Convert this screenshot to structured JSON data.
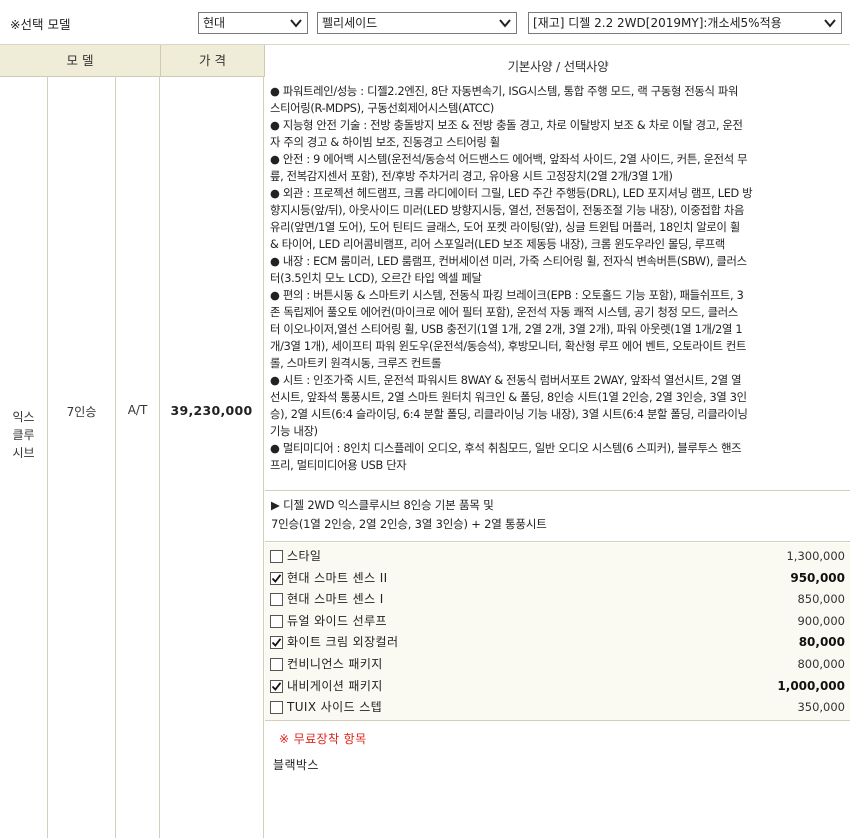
{
  "top": {
    "title": "※선택 모델",
    "brand_select": "현대",
    "model_select": "펠리세이드",
    "trim_select": "[재고] 디젤 2.2 2WD[2019MY]:개소세5%적용"
  },
  "header": {
    "model": "모 델",
    "price": "가 격",
    "spec": "기본사양 / 선택사양"
  },
  "row": {
    "trim": "익스\n클루\n시브",
    "seats": "7인승",
    "trans": "A/T",
    "price": "39,230,000"
  },
  "spec_lines": [
    "● 파워트레인/성능 : 디젤2.2엔진, 8단 자동변속기, ISG시스템, 통합 주행 모드, 랙 구동형 전동식 파워",
    "스티어링(R-MDPS), 구동선회제어시스템(ATCC)",
    "● 지능형 안전 기술 : 전방 충돌방지 보조 & 전방 충돌 경고, 차로 이탈방지 보조 & 차로 이탈 경고, 운전",
    "자 주의 경고 & 하이빔 보조, 진동경고 스티어링 휠",
    "● 안전 : 9 에어백 시스템(운전석/동승석 어드밴스드 에어백, 앞좌석 사이드, 2열 사이드, 커튼, 운전석 무",
    "릎, 전복감지센서 포함), 전/후방 주차거리 경고, 유아용 시트 고정장치(2열 2개/3열 1개)",
    "● 외관 : 프로젝션 헤드램프, 크롬 라디에이터 그릴, LED 주간 주행등(DRL), LED 포지셔닝 램프, LED 방",
    "향지시등(앞/뒤), 아웃사이드 미러(LED 방향지시등, 열선, 전동접이, 전동조절 기능 내장), 이중접합 차음",
    "유리(앞면/1열 도어), 도어 틴티드 글래스, 도어 포켓 라이팅(앞), 싱글 트윈팁 머플러, 18인치 알로이 휠",
    "& 타이어, LED 리어콤비램프, 리어 스포일러(LED 보조 제동등 내장), 크롬 윈도우라인 몰딩, 루프랙",
    "● 내장 : ECM 룸미러, LED 룸램프, 컨버세이션 미러, 가죽 스티어링 휠, 전자식 변속버튼(SBW), 클러스",
    "터(3.5인치 모노 LCD), 오르간 타입 엑셀 페달",
    "● 편의 : 버튼시동 & 스마트키 시스템, 전동식 파킹 브레이크(EPB : 오토홀드 기능 포함), 패들쉬프트, 3",
    "존 독립제어 풀오토 에어컨(마이크로 에어 필터 포함), 운전석 자동 쾌적 시스템, 공기 청정 모드, 클러스",
    "터 이오나이저,열선 스티어링 휠, USB 충전기(1열 1개, 2열 2개, 3열 2개), 파워 아웃렛(1열 1개/2열 1",
    "개/3열 1개), 세이프티 파워 윈도우(운전석/동승석), 후방모니터, 확산형 루프 에어 벤트, 오토라이트 컨트",
    "롤, 스마트키 원격시동, 크루즈 컨트롤",
    "● 시트 : 인조가죽 시트, 운전석 파워시트 8WAY & 전동식 럼버서포트 2WAY, 앞좌석 열선시트, 2열 열",
    "선시트, 앞좌석 통풍시트, 2열 스마트 원터치 워크인 & 폴딩, 8인승 시트(1열 2인승, 2열 3인승, 3열 3인",
    "승), 2열 시트(6:4 슬라이딩, 6:4 분할 폴딩, 리클라이닝 기능 내장), 3열 시트(6:4 분할 폴딩, 리클라이닝",
    "기능 내장)",
    "● 멀티미디어 : 8인치 디스플레이 오디오, 후석 취침모드, 일반 오디오 시스템(6 스피커), 블루투스 핸즈",
    "프리, 멀티미디어용 USB 단자"
  ],
  "base_note": [
    "▶ 디젤 2WD 익스클루시브 8인승 기본 품목 및",
    "7인승(1열 2인승, 2열 2인승, 3열 3인승) + 2열 통풍시트"
  ],
  "options": [
    {
      "name": "스타일",
      "price": "1,300,000",
      "checked": false
    },
    {
      "name": "현대 스마트 센스 II",
      "price": "950,000",
      "checked": true
    },
    {
      "name": "현대 스마트 센스 I",
      "price": "850,000",
      "checked": false
    },
    {
      "name": "듀얼 와이드 선루프",
      "price": "900,000",
      "checked": false
    },
    {
      "name": "화이트 크림 외장컬러",
      "price": "80,000",
      "checked": true
    },
    {
      "name": "컨비니언스 패키지",
      "price": "800,000",
      "checked": false
    },
    {
      "name": "내비게이션 패키지",
      "price": "1,000,000",
      "checked": true
    },
    {
      "name": "TUIX 사이드 스텝",
      "price": "350,000",
      "checked": false
    }
  ],
  "free": {
    "title": "※ 무료장착 항목",
    "items": [
      "블랙박스"
    ]
  },
  "colors": {
    "header_bg": "#efecd8",
    "option_bg": "#fbfaf2",
    "free_title": "#e0241b"
  }
}
